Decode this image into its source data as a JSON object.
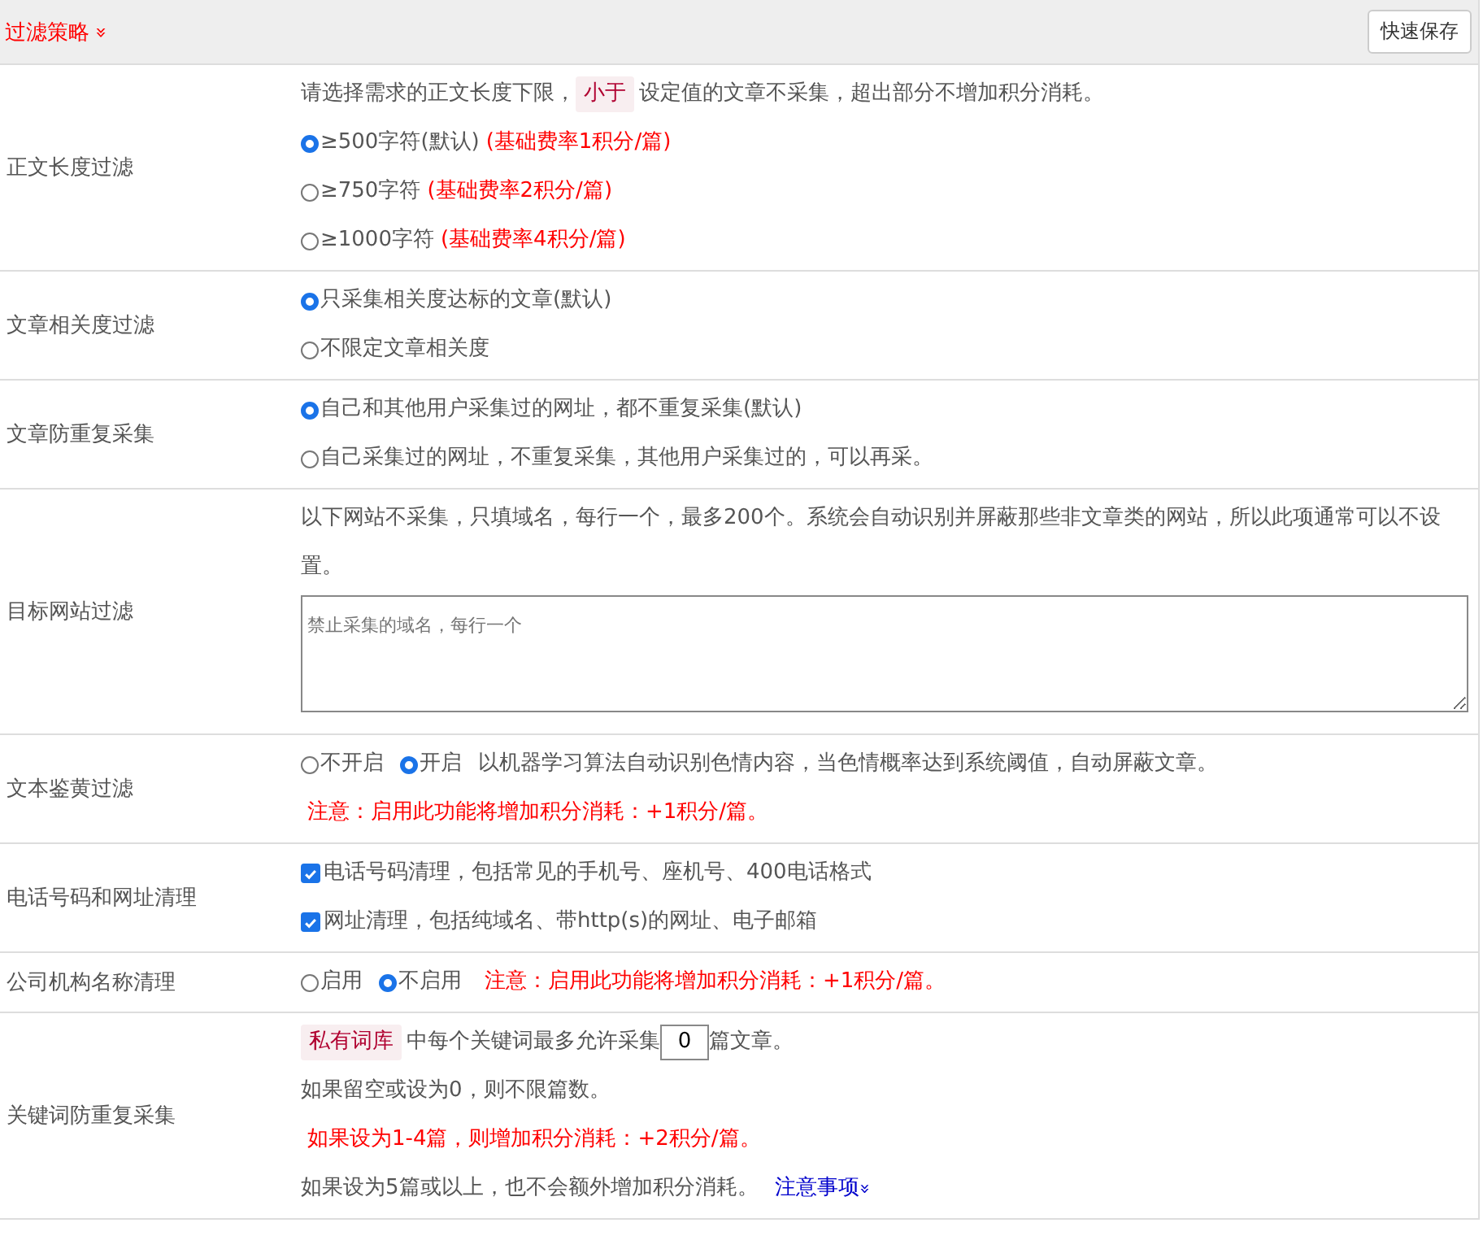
{
  "header": {
    "title": "过滤策略",
    "toggle": "»",
    "save_button": "快速保存"
  },
  "rows": [
    {
      "label": "正文长度过滤",
      "items": [
        {
          "kind": "note",
          "parts": [
            {
              "text": "请选择需求的正文长度下限，"
            },
            {
              "text": "小于",
              "tag": true
            },
            {
              "text": "设定值的文章不采集，超出部分不增加积分消耗。"
            }
          ]
        },
        {
          "kind": "radio",
          "options": [
            {
              "label": "≥500字符(默认)",
              "extra": "(基础费率1积分/篇)",
              "selected": true
            }
          ]
        },
        {
          "kind": "radio",
          "options": [
            {
              "label": "≥750字符",
              "extra": "(基础费率2积分/篇)",
              "selected": false
            }
          ]
        },
        {
          "kind": "radio",
          "options": [
            {
              "label": "≥1000字符",
              "extra": "(基础费率4积分/篇)",
              "selected": false
            }
          ]
        }
      ]
    },
    {
      "label": "文章相关度过滤",
      "items": [
        {
          "kind": "radio",
          "options": [
            {
              "label": "只采集相关度达标的文章(默认)",
              "selected": true
            }
          ]
        },
        {
          "kind": "radio",
          "options": [
            {
              "label": "不限定文章相关度",
              "selected": false
            }
          ]
        }
      ]
    },
    {
      "label": "文章防重复采集",
      "items": [
        {
          "kind": "radio",
          "options": [
            {
              "label": "自己和其他用户采集过的网址，都不重复采集(默认)",
              "selected": true
            }
          ]
        },
        {
          "kind": "radio",
          "options": [
            {
              "label": "自己采集过的网址，不重复采集，其他用户采集过的，可以再采。",
              "selected": false
            }
          ]
        }
      ]
    },
    {
      "label": "目标网站过滤",
      "items": [
        {
          "kind": "note",
          "parts": [
            {
              "text": "以下网站不采集，只填域名，每行一个，最多200个。系统会自动识别并屏蔽那些非文章类的网站，所以此项通常可以不设置。"
            }
          ]
        },
        {
          "kind": "textarea",
          "placeholder": "禁止采集的域名，每行一个"
        }
      ]
    },
    {
      "label": "文本鉴黄过滤",
      "items": [
        {
          "kind": "radio",
          "options": [
            {
              "label": "不开启",
              "selected": false
            },
            {
              "label": "开启",
              "selected": true
            }
          ],
          "tail": "以机器学习算法自动识别色情内容，当色情概率达到系统阈值，自动屏蔽文章。"
        },
        {
          "kind": "warn",
          "text": "注意：启用此功能将增加积分消耗：+1积分/篇。"
        }
      ]
    },
    {
      "label": "电话号码和网址清理",
      "items": [
        {
          "kind": "checkbox",
          "label": "电话号码清理，包括常见的手机号、座机号、400电话格式",
          "checked": true
        },
        {
          "kind": "checkbox",
          "label": "网址清理，包括纯域名、带http(s)的网址、电子邮箱",
          "checked": true
        }
      ]
    },
    {
      "label": "公司机构名称清理",
      "items": [
        {
          "kind": "radio",
          "options": [
            {
              "label": "启用",
              "selected": false
            },
            {
              "label": "不启用",
              "selected": true
            }
          ],
          "warn": "注意：启用此功能将增加积分消耗：+1积分/篇。"
        }
      ]
    },
    {
      "label": "关键词防重复采集",
      "items": [
        {
          "kind": "count",
          "tag": "私有词库",
          "before": "中每个关键词最多允许采集",
          "value": "0",
          "after": "篇文章。"
        },
        {
          "kind": "note",
          "parts": [
            {
              "text": "如果留空或设为0，则不限篇数。"
            }
          ]
        },
        {
          "kind": "warn",
          "text": "如果设为1-4篇，则增加积分消耗：+2积分/篇。"
        },
        {
          "kind": "note",
          "parts": [
            {
              "text": "如果设为5篇或以上，也不会额外增加积分消耗。"
            }
          ],
          "link": "注意事项",
          "link_toggle": "»"
        }
      ]
    }
  ]
}
